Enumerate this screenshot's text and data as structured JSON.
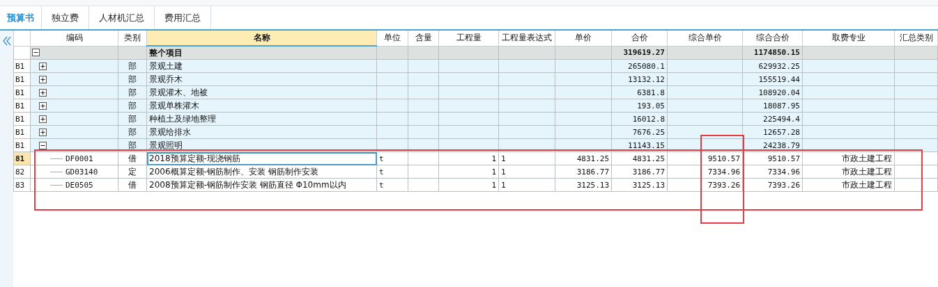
{
  "tabs": [
    {
      "label": "预算书",
      "selected": true
    },
    {
      "label": "独立费",
      "selected": false
    },
    {
      "label": "人材机汇总",
      "selected": false
    },
    {
      "label": "费用汇总",
      "selected": false
    }
  ],
  "columns": [
    {
      "label": "编码",
      "selected": false
    },
    {
      "label": "类别",
      "selected": false
    },
    {
      "label": "名称",
      "selected": true
    },
    {
      "label": "单位",
      "selected": false
    },
    {
      "label": "含量",
      "selected": false
    },
    {
      "label": "工程量",
      "selected": false
    },
    {
      "label": "工程量表达式",
      "selected": false
    },
    {
      "label": "单价",
      "selected": false
    },
    {
      "label": "合价",
      "selected": false
    },
    {
      "label": "综合单价",
      "selected": false
    },
    {
      "label": "综合合价",
      "selected": false
    },
    {
      "label": "取费专业",
      "selected": false
    },
    {
      "label": "汇总类别",
      "selected": false
    }
  ],
  "tree": [
    {
      "kind": "root",
      "expanded": true,
      "selected": false,
      "name": "整个项目",
      "total": "319619.27",
      "comp_total": "1174850.15",
      "children": [
        {
          "kind": "section",
          "row_number": "B1",
          "expanded": false,
          "selected": false,
          "category": "部",
          "name": "景观土建",
          "total": "265080.1",
          "comp_total": "629932.25"
        },
        {
          "kind": "section",
          "row_number": "B1",
          "expanded": false,
          "selected": false,
          "category": "部",
          "name": "景观乔木",
          "total": "13132.12",
          "comp_total": "155519.44"
        },
        {
          "kind": "section",
          "row_number": "B1",
          "expanded": false,
          "selected": false,
          "category": "部",
          "name": "景观灌木、地被",
          "total": "6381.8",
          "comp_total": "108920.04"
        },
        {
          "kind": "section",
          "row_number": "B1",
          "expanded": false,
          "selected": false,
          "category": "部",
          "name": "景观单株灌木",
          "total": "193.05",
          "comp_total": "18087.95"
        },
        {
          "kind": "section",
          "row_number": "B1",
          "expanded": false,
          "selected": false,
          "category": "部",
          "name": "种植土及绿地整理",
          "total": "16012.8",
          "comp_total": "225494.4"
        },
        {
          "kind": "section",
          "row_number": "B1",
          "expanded": false,
          "selected": false,
          "category": "部",
          "name": "景观给排水",
          "total": "7676.25",
          "comp_total": "12657.28"
        },
        {
          "kind": "section",
          "row_number": "B1",
          "expanded": true,
          "selected": false,
          "category": "部",
          "name": "景观照明",
          "total": "11143.15",
          "comp_total": "24238.79",
          "children": [
            {
              "kind": "item",
              "row_number": "81",
              "selected": true,
              "code": "DF0001",
              "category": "借",
              "name": "2018预算定额-现浇钢筋",
              "unit": "t",
              "quantity": "1",
              "expression": "1",
              "unit_price": "4831.25",
              "total": "4831.25",
              "comp_unit_price": "9510.57",
              "comp_total": "9510.57",
              "fee_specialty": "市政土建工程"
            },
            {
              "kind": "item",
              "row_number": "82",
              "selected": false,
              "code": "GD03140",
              "category": "定",
              "name": "2006概算定额-钢筋制作、安装 钢筋制作安装",
              "unit": "t",
              "quantity": "1",
              "expression": "1",
              "unit_price": "3186.77",
              "total": "3186.77",
              "comp_unit_price": "7334.96",
              "comp_total": "7334.96",
              "fee_specialty": "市政土建工程"
            },
            {
              "kind": "item",
              "row_number": "83",
              "selected": false,
              "code": "DE0505",
              "category": "借",
              "name": "2008预算定额-钢筋制作安装 钢筋直径 Φ10mm以内",
              "unit": "t",
              "quantity": "1",
              "expression": "1",
              "unit_price": "3125.13",
              "total": "3125.13",
              "comp_unit_price": "7393.26",
              "comp_total": "7393.26",
              "fee_specialty": "市政土建工程"
            }
          ]
        }
      ]
    }
  ]
}
